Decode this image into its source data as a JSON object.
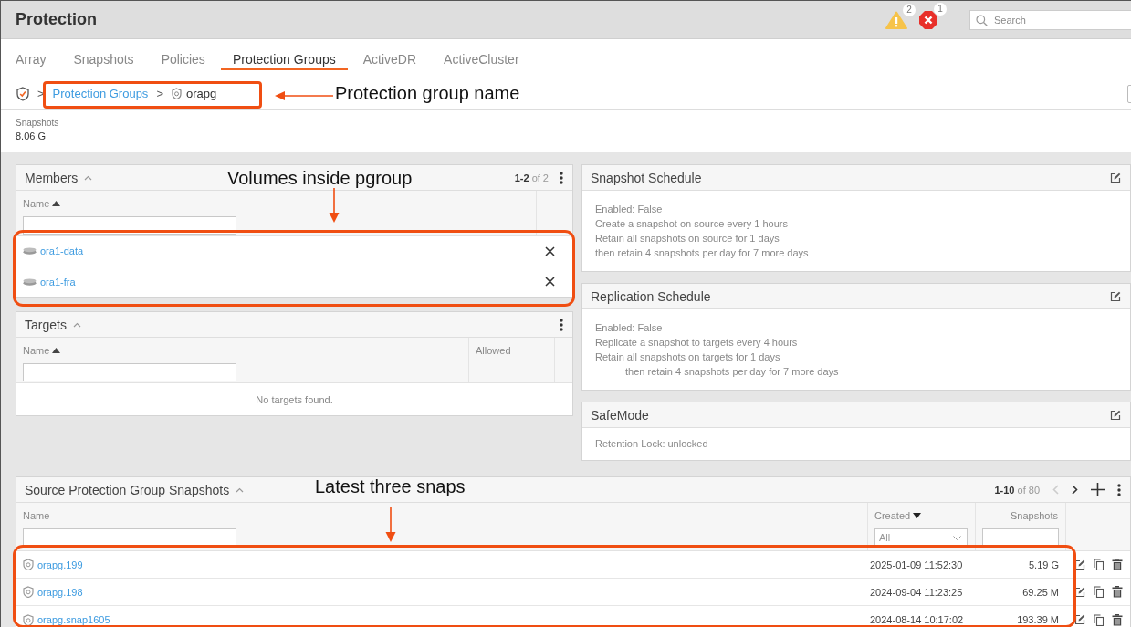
{
  "header": {
    "title": "Protection",
    "alerts": [
      {
        "kind": "warning",
        "count": "2"
      },
      {
        "kind": "error",
        "count": "1"
      }
    ],
    "search": {
      "placeholder": "Search"
    }
  },
  "tabs": [
    {
      "label": "Array",
      "selected": false
    },
    {
      "label": "Snapshots",
      "selected": false
    },
    {
      "label": "Policies",
      "selected": false
    },
    {
      "label": "Protection Groups",
      "selected": true
    },
    {
      "label": "ActiveDR",
      "selected": false
    },
    {
      "label": "ActiveCluster",
      "selected": false
    }
  ],
  "breadcrumb": [
    {
      "kind": "separator",
      "text": ">"
    },
    {
      "kind": "link",
      "text": "Protection Groups"
    },
    {
      "kind": "separator",
      "text": ">"
    },
    {
      "kind": "current",
      "text": "orapg"
    }
  ],
  "stats": [
    {
      "label": "Snapshots",
      "value": "8.06 G"
    }
  ],
  "members": {
    "title": "Members",
    "pager": {
      "range": "1-2",
      "total": "of 2"
    },
    "columns": [
      {
        "label": "Name",
        "ascending": true,
        "filter": {
          "kind": "text"
        }
      }
    ],
    "rows": [
      {
        "name": "ora1-data"
      },
      {
        "name": "ora1-fra"
      }
    ]
  },
  "targets": {
    "title": "Targets",
    "columns": [
      {
        "label": "Name",
        "ascending": true,
        "filter": {
          "kind": "text"
        }
      },
      {
        "label": "Allowed"
      }
    ],
    "empty": "No targets found."
  },
  "schedules": [
    {
      "title": "Snapshot Schedule",
      "lines": [
        {
          "text": "Enabled: False",
          "indented": false
        },
        {
          "text": "Create a snapshot on source every 1 hours",
          "indented": false
        },
        {
          "text": "Retain all snapshots on source for 1 days",
          "indented": false
        },
        {
          "text": "then retain 4 snapshots per day for 7 more days",
          "indented": false
        }
      ]
    },
    {
      "title": "Replication Schedule",
      "lines": [
        {
          "text": "Enabled: False",
          "indented": false
        },
        {
          "text": "Replicate a snapshot to targets every 4 hours",
          "indented": false
        },
        {
          "text": "Retain all snapshots on targets for 1 days",
          "indented": false
        },
        {
          "text": "then retain 4 snapshots per day for 7 more days",
          "indented": true
        }
      ]
    },
    {
      "title": "SafeMode",
      "lines": [
        {
          "text": "Retention Lock: unlocked",
          "indented": false
        }
      ]
    }
  ],
  "snapshots": {
    "title": "Source Protection Group Snapshots",
    "pager": {
      "range": "1-10",
      "total": "of 80",
      "prev_enabled": false,
      "next_enabled": true
    },
    "columns": [
      {
        "label": "Name",
        "filter": {
          "kind": "text"
        }
      },
      {
        "label": "Created",
        "ascending": false,
        "filter": {
          "kind": "select",
          "value": "All"
        }
      },
      {
        "label": "Snapshots",
        "filter": {
          "kind": "text"
        }
      }
    ],
    "rows": [
      {
        "name": "orapg.199",
        "created": "2025-01-09 11:52:30",
        "size": "5.19 G"
      },
      {
        "name": "orapg.198",
        "created": "2024-09-04 11:23:25",
        "size": "69.25 M"
      },
      {
        "name": "orapg.snap1605",
        "created": "2024-08-14 10:17:02",
        "size": "193.39 M"
      }
    ]
  },
  "annotations": [
    {
      "text": "Protection group name"
    },
    {
      "text": "Volumes inside pgroup"
    },
    {
      "text": "Latest three snaps"
    }
  ]
}
